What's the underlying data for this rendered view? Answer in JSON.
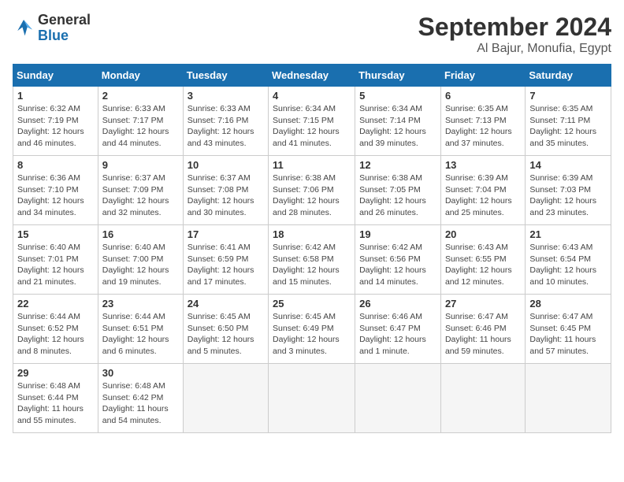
{
  "logo": {
    "general": "General",
    "blue": "Blue"
  },
  "title": "September 2024",
  "subtitle": "Al Bajur, Monufia, Egypt",
  "days_of_week": [
    "Sunday",
    "Monday",
    "Tuesday",
    "Wednesday",
    "Thursday",
    "Friday",
    "Saturday"
  ],
  "weeks": [
    [
      {
        "day": "1",
        "info": "Sunrise: 6:32 AM\nSunset: 7:19 PM\nDaylight: 12 hours and 46 minutes."
      },
      {
        "day": "2",
        "info": "Sunrise: 6:33 AM\nSunset: 7:17 PM\nDaylight: 12 hours and 44 minutes."
      },
      {
        "day": "3",
        "info": "Sunrise: 6:33 AM\nSunset: 7:16 PM\nDaylight: 12 hours and 43 minutes."
      },
      {
        "day": "4",
        "info": "Sunrise: 6:34 AM\nSunset: 7:15 PM\nDaylight: 12 hours and 41 minutes."
      },
      {
        "day": "5",
        "info": "Sunrise: 6:34 AM\nSunset: 7:14 PM\nDaylight: 12 hours and 39 minutes."
      },
      {
        "day": "6",
        "info": "Sunrise: 6:35 AM\nSunset: 7:13 PM\nDaylight: 12 hours and 37 minutes."
      },
      {
        "day": "7",
        "info": "Sunrise: 6:35 AM\nSunset: 7:11 PM\nDaylight: 12 hours and 35 minutes."
      }
    ],
    [
      {
        "day": "8",
        "info": "Sunrise: 6:36 AM\nSunset: 7:10 PM\nDaylight: 12 hours and 34 minutes."
      },
      {
        "day": "9",
        "info": "Sunrise: 6:37 AM\nSunset: 7:09 PM\nDaylight: 12 hours and 32 minutes."
      },
      {
        "day": "10",
        "info": "Sunrise: 6:37 AM\nSunset: 7:08 PM\nDaylight: 12 hours and 30 minutes."
      },
      {
        "day": "11",
        "info": "Sunrise: 6:38 AM\nSunset: 7:06 PM\nDaylight: 12 hours and 28 minutes."
      },
      {
        "day": "12",
        "info": "Sunrise: 6:38 AM\nSunset: 7:05 PM\nDaylight: 12 hours and 26 minutes."
      },
      {
        "day": "13",
        "info": "Sunrise: 6:39 AM\nSunset: 7:04 PM\nDaylight: 12 hours and 25 minutes."
      },
      {
        "day": "14",
        "info": "Sunrise: 6:39 AM\nSunset: 7:03 PM\nDaylight: 12 hours and 23 minutes."
      }
    ],
    [
      {
        "day": "15",
        "info": "Sunrise: 6:40 AM\nSunset: 7:01 PM\nDaylight: 12 hours and 21 minutes."
      },
      {
        "day": "16",
        "info": "Sunrise: 6:40 AM\nSunset: 7:00 PM\nDaylight: 12 hours and 19 minutes."
      },
      {
        "day": "17",
        "info": "Sunrise: 6:41 AM\nSunset: 6:59 PM\nDaylight: 12 hours and 17 minutes."
      },
      {
        "day": "18",
        "info": "Sunrise: 6:42 AM\nSunset: 6:58 PM\nDaylight: 12 hours and 15 minutes."
      },
      {
        "day": "19",
        "info": "Sunrise: 6:42 AM\nSunset: 6:56 PM\nDaylight: 12 hours and 14 minutes."
      },
      {
        "day": "20",
        "info": "Sunrise: 6:43 AM\nSunset: 6:55 PM\nDaylight: 12 hours and 12 minutes."
      },
      {
        "day": "21",
        "info": "Sunrise: 6:43 AM\nSunset: 6:54 PM\nDaylight: 12 hours and 10 minutes."
      }
    ],
    [
      {
        "day": "22",
        "info": "Sunrise: 6:44 AM\nSunset: 6:52 PM\nDaylight: 12 hours and 8 minutes."
      },
      {
        "day": "23",
        "info": "Sunrise: 6:44 AM\nSunset: 6:51 PM\nDaylight: 12 hours and 6 minutes."
      },
      {
        "day": "24",
        "info": "Sunrise: 6:45 AM\nSunset: 6:50 PM\nDaylight: 12 hours and 5 minutes."
      },
      {
        "day": "25",
        "info": "Sunrise: 6:45 AM\nSunset: 6:49 PM\nDaylight: 12 hours and 3 minutes."
      },
      {
        "day": "26",
        "info": "Sunrise: 6:46 AM\nSunset: 6:47 PM\nDaylight: 12 hours and 1 minute."
      },
      {
        "day": "27",
        "info": "Sunrise: 6:47 AM\nSunset: 6:46 PM\nDaylight: 11 hours and 59 minutes."
      },
      {
        "day": "28",
        "info": "Sunrise: 6:47 AM\nSunset: 6:45 PM\nDaylight: 11 hours and 57 minutes."
      }
    ],
    [
      {
        "day": "29",
        "info": "Sunrise: 6:48 AM\nSunset: 6:44 PM\nDaylight: 11 hours and 55 minutes."
      },
      {
        "day": "30",
        "info": "Sunrise: 6:48 AM\nSunset: 6:42 PM\nDaylight: 11 hours and 54 minutes."
      },
      null,
      null,
      null,
      null,
      null
    ]
  ]
}
